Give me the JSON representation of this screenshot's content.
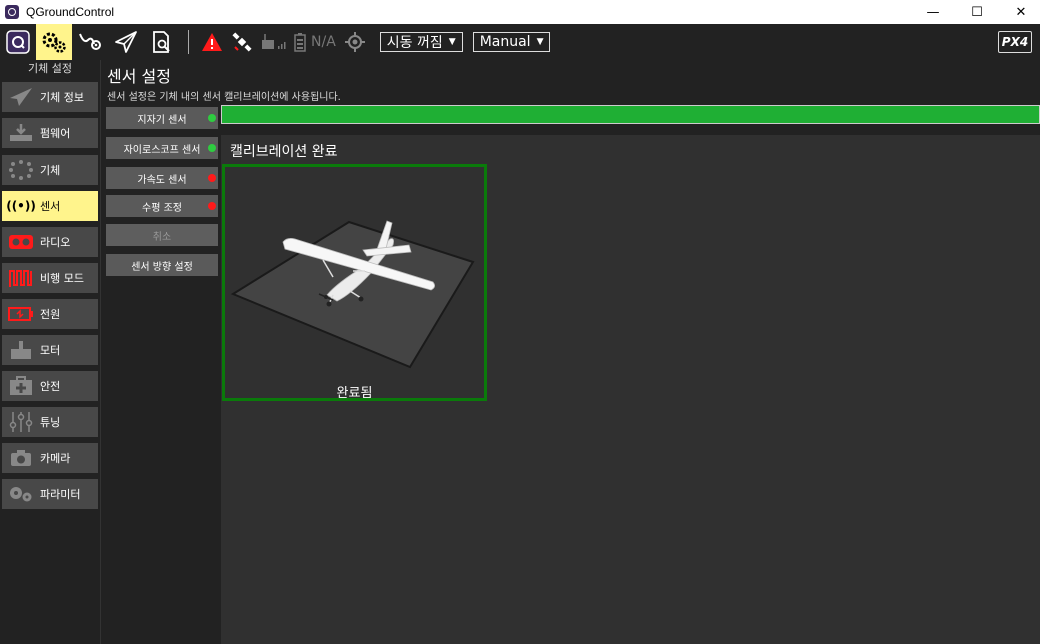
{
  "window": {
    "title": "QGroundControl"
  },
  "toolbar": {
    "gps_status": "N/A",
    "arm_state": "시동 꺼짐",
    "flight_mode": "Manual",
    "brand": "PX4"
  },
  "sidebar": {
    "header": "기체 설정",
    "items": [
      {
        "label": "기체 정보",
        "icon": "plane-icon"
      },
      {
        "label": "펌웨어",
        "icon": "download-icon"
      },
      {
        "label": "기체",
        "icon": "airframe-icon"
      },
      {
        "label": "센서",
        "icon": "sensor-icon"
      },
      {
        "label": "라디오",
        "icon": "radio-icon"
      },
      {
        "label": "비행 모드",
        "icon": "flight-mode-icon"
      },
      {
        "label": "전원",
        "icon": "battery-icon"
      },
      {
        "label": "모터",
        "icon": "motor-icon"
      },
      {
        "label": "안전",
        "icon": "safety-icon"
      },
      {
        "label": "튜닝",
        "icon": "tuning-icon"
      },
      {
        "label": "카메라",
        "icon": "camera-icon"
      },
      {
        "label": "파라미터",
        "icon": "parameters-icon"
      }
    ],
    "active_index": 3
  },
  "main": {
    "title": "센서 설정",
    "description": "센서 설정은 기체 내의 센서 캘리브레이션에 사용됩니다.",
    "sensors": [
      {
        "label": "지자기 센서",
        "status": "green"
      },
      {
        "label": "자이로스코프 센서",
        "status": "green"
      },
      {
        "label": "가속도 센서",
        "status": "red"
      },
      {
        "label": "수평 조정",
        "status": "red"
      },
      {
        "label": "취소",
        "status": ""
      },
      {
        "label": "센서 방향 설정",
        "status": ""
      }
    ],
    "progress": 1.0,
    "calibration_status": "캘리브레이션 완료",
    "card_status": "완료됨"
  },
  "colors": {
    "active": "#fff48c",
    "progress": "#1faf34",
    "green_dot": "#2ecc40",
    "red_dot": "#ff1a1a",
    "card_border": "#0a7a0a"
  }
}
